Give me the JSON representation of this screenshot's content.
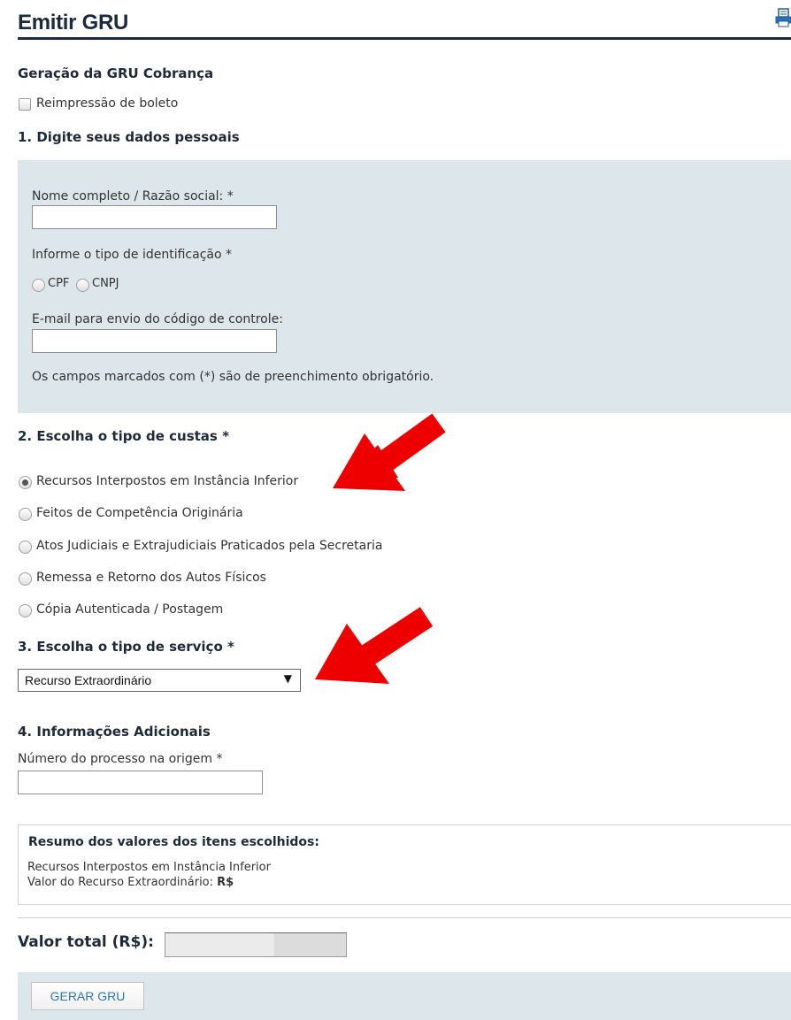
{
  "header": {
    "title": "Emitir GRU",
    "print_icon": "print-icon"
  },
  "generation": {
    "heading": "Geração da GRU Cobrança",
    "reprint_label": "Reimpressão de boleto",
    "reprint_checked": false
  },
  "section1": {
    "heading": "1. Digite seus dados pessoais",
    "name_label": "Nome completo / Razão social: *",
    "name_value": "",
    "id_type_label": "Informe o tipo de identificação *",
    "id_options": [
      "CPF",
      "CNPJ"
    ],
    "email_label": "E-mail para envio do código de controle:",
    "email_value": "",
    "required_note": "Os campos marcados com (*) são de preenchimento obrigatório."
  },
  "section2": {
    "heading": "2. Escolha o tipo de custas *",
    "options": [
      "Recursos Interpostos em Instância Inferior",
      "Feitos de Competência Originária",
      "Atos Judiciais e Extrajudiciais Praticados pela Secretaria",
      "Remessa e Retorno dos Autos Físicos",
      "Cópia Autenticada / Postagem"
    ],
    "selected_index": 0
  },
  "section3": {
    "heading": "3. Escolha o tipo de serviço *",
    "selected_service": "Recurso Extraordinário",
    "arrow_glyph": "▼"
  },
  "section4": {
    "heading": "4. Informações Adicionais",
    "process_label": "Número do processo na origem *",
    "process_value": ""
  },
  "summary": {
    "title": "Resumo dos valores dos itens escolhidos:",
    "line1": "Recursos Interpostos em Instância Inferior",
    "line2_label": "Valor do Recurso Extraordinário: ",
    "line2_currency": "R$"
  },
  "total": {
    "label": "Valor total (R$):",
    "value": ""
  },
  "actions": {
    "generate_label": "GERAR GRU"
  },
  "colors": {
    "title_navy": "#1c2a3d",
    "panel_bg": "#dde6ea",
    "button_text": "#2a7ab8",
    "annotation_red": "#ee0000"
  }
}
